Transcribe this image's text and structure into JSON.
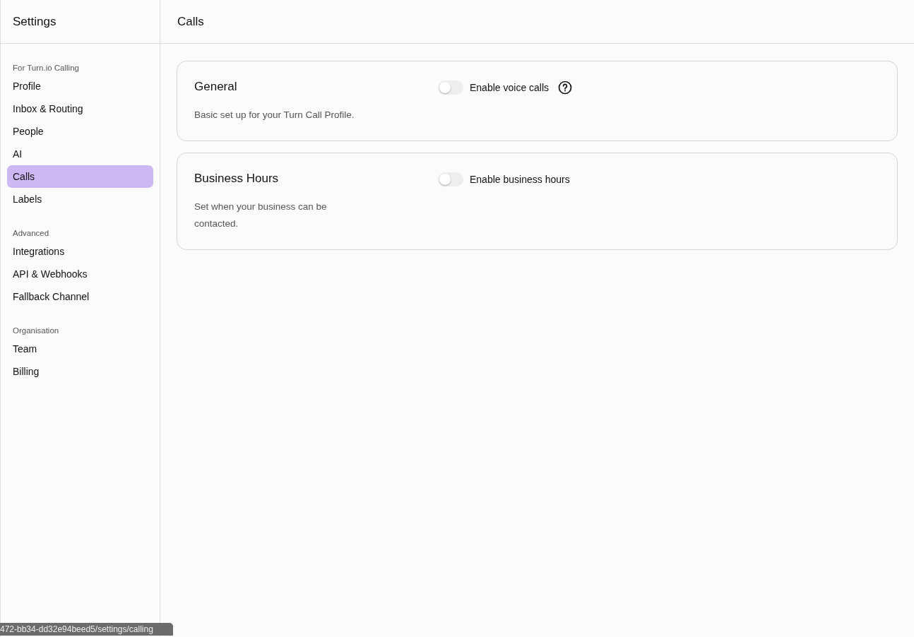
{
  "sidebar": {
    "title": "Settings",
    "sections": [
      {
        "heading": "For Turn.io Calling",
        "items": [
          {
            "label": "Profile",
            "selected": false
          },
          {
            "label": "Inbox & Routing",
            "selected": false
          },
          {
            "label": "People",
            "selected": false
          },
          {
            "label": "AI",
            "selected": false
          },
          {
            "label": "Calls",
            "selected": true
          },
          {
            "label": "Labels",
            "selected": false
          }
        ]
      },
      {
        "heading": "Advanced",
        "items": [
          {
            "label": "Integrations",
            "selected": false
          },
          {
            "label": "API & Webhooks",
            "selected": false
          },
          {
            "label": "Fallback Channel",
            "selected": false
          }
        ]
      },
      {
        "heading": "Organisation",
        "items": [
          {
            "label": "Team",
            "selected": false
          },
          {
            "label": "Billing",
            "selected": false
          }
        ]
      }
    ]
  },
  "page": {
    "title": "Calls",
    "cards": [
      {
        "title": "General",
        "description": "Basic set up for your Turn Call Profile.",
        "toggle": {
          "label": "Enable voice calls",
          "on": false,
          "help": true
        }
      },
      {
        "title": "Business Hours",
        "description": "Set when your business can be contacted.",
        "toggle": {
          "label": "Enable business hours",
          "on": false,
          "help": false
        }
      }
    ]
  },
  "status_bar": {
    "url": "472-bb34-dd32e94beed5/settings/calling"
  }
}
